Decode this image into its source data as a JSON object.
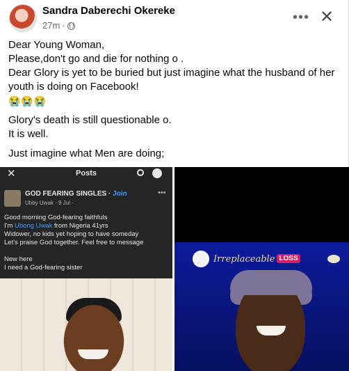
{
  "post": {
    "author": "Sandra Daberechi Okereke",
    "time": "27m",
    "privacy_icon": "globe-icon",
    "more_label": "•••",
    "close_label": "✕",
    "lines": [
      "Dear Young Woman,",
      "Please,don't go and die for nothing o .",
      "Dear Glory is yet to be buried but just imagine what the husband of her youth is doing on Facebook!",
      "😭😭😭",
      "Glory's death is still questionable o.",
      "It is well.",
      "Just imagine what Men are doing;"
    ]
  },
  "screenshot": {
    "close": "✕",
    "title": "Posts",
    "group_name": "GOD FEARING SINGLES",
    "join": "Join",
    "sub": "Ubby Uwak · 9 Jul ·",
    "more": "•••",
    "line1": "Good morning God-fearing faithfuls",
    "line2_pre": "I'm ",
    "line2_name": "Ubong Uwak",
    "line2_post": " from Nigeria 41yrs",
    "line3": "Widower, no kids yet hoping to have someday",
    "line4": "Let's praise God together. Feel free to message",
    "line5": "New here",
    "line6": "I need a God-fearing sister"
  },
  "memorial": {
    "title": "Irreplaceable",
    "loss": "LOSS"
  }
}
